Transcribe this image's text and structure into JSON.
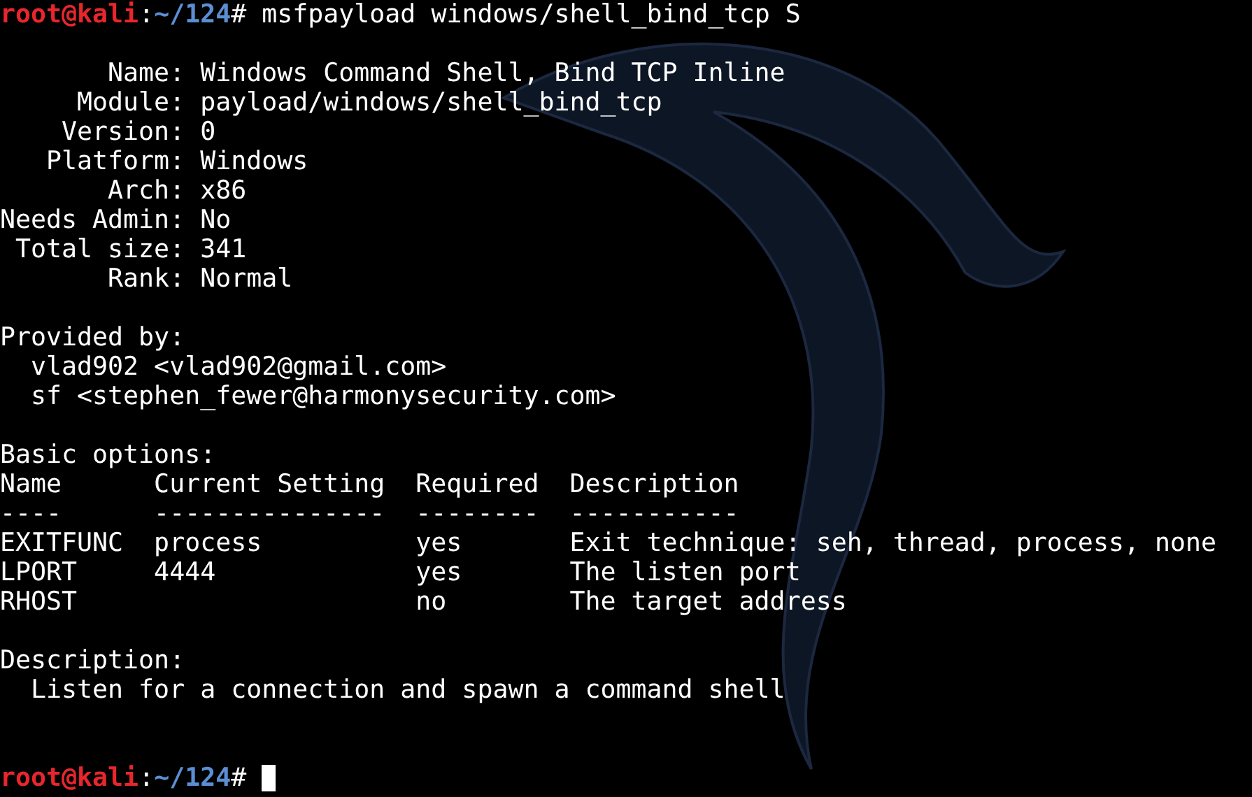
{
  "lines": [
    {
      "kind": "prompt",
      "user": "root@kali",
      "sep": ":",
      "path": "~/124",
      "sign": "#",
      "command": "msfpayload windows/shell_bind_tcp S"
    },
    {
      "kind": "blank"
    },
    {
      "kind": "output",
      "text": "       Name: Windows Command Shell, Bind TCP Inline"
    },
    {
      "kind": "output",
      "text": "     Module: payload/windows/shell_bind_tcp"
    },
    {
      "kind": "output",
      "text": "    Version: 0"
    },
    {
      "kind": "output",
      "text": "   Platform: Windows"
    },
    {
      "kind": "output",
      "text": "       Arch: x86"
    },
    {
      "kind": "output",
      "text": "Needs Admin: No"
    },
    {
      "kind": "output",
      "text": " Total size: 341"
    },
    {
      "kind": "output",
      "text": "       Rank: Normal"
    },
    {
      "kind": "blank"
    },
    {
      "kind": "output",
      "text": "Provided by:"
    },
    {
      "kind": "output",
      "text": "  vlad902 <vlad902@gmail.com>"
    },
    {
      "kind": "output",
      "text": "  sf <stephen_fewer@harmonysecurity.com>"
    },
    {
      "kind": "blank"
    },
    {
      "kind": "output",
      "text": "Basic options:"
    },
    {
      "kind": "output",
      "text": "Name      Current Setting  Required  Description"
    },
    {
      "kind": "output",
      "text": "----      ---------------  --------  -----------"
    },
    {
      "kind": "output",
      "text": "EXITFUNC  process          yes       Exit technique: seh, thread, process, none"
    },
    {
      "kind": "output",
      "text": "LPORT     4444             yes       The listen port"
    },
    {
      "kind": "output",
      "text": "RHOST                      no        The target address"
    },
    {
      "kind": "blank"
    },
    {
      "kind": "output",
      "text": "Description:"
    },
    {
      "kind": "output",
      "text": "  Listen for a connection and spawn a command shell"
    },
    {
      "kind": "blank"
    },
    {
      "kind": "blank"
    },
    {
      "kind": "prompt",
      "user": "root@kali",
      "sep": ":",
      "path": "~/124",
      "sign": "#",
      "cursor": true
    }
  ]
}
